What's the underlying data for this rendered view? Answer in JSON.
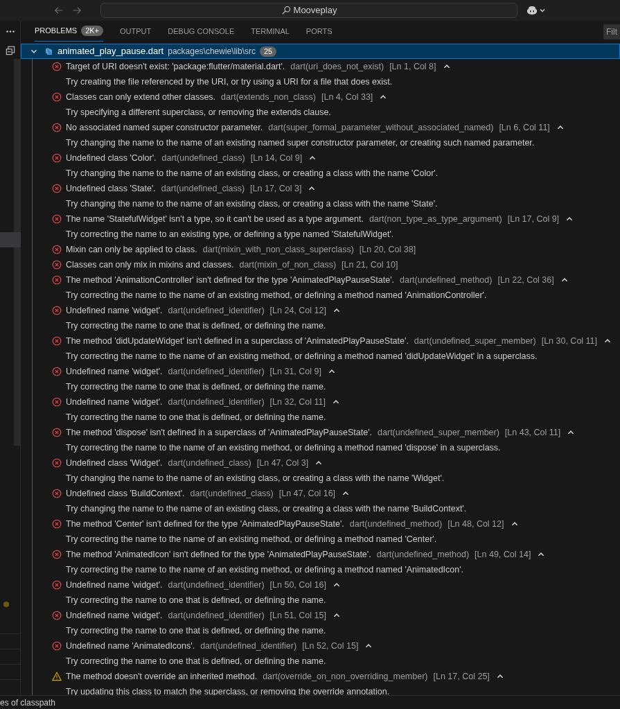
{
  "title_bar": {
    "search": "Mooveplay"
  },
  "panel": {
    "tabs": [
      {
        "label": "PROBLEMS",
        "selected": true,
        "badge": "2K+"
      },
      {
        "label": "OUTPUT",
        "selected": false
      },
      {
        "label": "DEBUG CONSOLE",
        "selected": false
      },
      {
        "label": "TERMINAL",
        "selected": false
      },
      {
        "label": "PORTS",
        "selected": false
      }
    ],
    "filter": {
      "placeholder": "Filt"
    }
  },
  "file": {
    "name": "animated_play_pause.dart",
    "path": "packages\\chewie\\lib\\src",
    "count": "25",
    "expanded": true,
    "selected": true
  },
  "problems": [
    {
      "kind": "error",
      "message": "Target of URI doesn't exist: 'package:flutter/material.dart'.",
      "source": "dart(uri_does_not_exist)",
      "location": "[Ln 1, Col 8]",
      "hint": "Try creating the file referenced by the URI, or try using a URI for a file that does exist."
    },
    {
      "kind": "error",
      "message": "Classes can only extend other classes.",
      "source": "dart(extends_non_class)",
      "location": "[Ln 4, Col 33]",
      "hint": "Try specifying a different superclass, or removing the extends clause."
    },
    {
      "kind": "error",
      "message": "No associated named super constructor parameter.",
      "source": "dart(super_formal_parameter_without_associated_named)",
      "location": "[Ln 6, Col 11]",
      "hint": "Try changing the name to the name of an existing named super constructor parameter, or creating such named parameter."
    },
    {
      "kind": "error",
      "message": "Undefined class 'Color'.",
      "source": "dart(undefined_class)",
      "location": "[Ln 14, Col 9]",
      "hint": "Try changing the name to the name of an existing class, or creating a class with the name 'Color'."
    },
    {
      "kind": "error",
      "message": "Undefined class 'State'.",
      "source": "dart(undefined_class)",
      "location": "[Ln 17, Col 3]",
      "hint": "Try changing the name to the name of an existing class, or creating a class with the name 'State'."
    },
    {
      "kind": "error",
      "message": "The name 'StatefulWidget' isn't a type, so it can't be used as a type argument.",
      "source": "dart(non_type_as_type_argument)",
      "location": "[Ln 17, Col 9]",
      "hint": "Try correcting the name to an existing type, or defining a type named 'StatefulWidget'."
    },
    {
      "kind": "error",
      "message": "Mixin can only be applied to class.",
      "source": "dart(mixin_with_non_class_superclass)",
      "location": "[Ln 20, Col 38]"
    },
    {
      "kind": "error",
      "message": "Classes can only mix in mixins and classes.",
      "source": "dart(mixin_of_non_class)",
      "location": "[Ln 21, Col 10]"
    },
    {
      "kind": "error",
      "message": "The method 'AnimationController' isn't defined for the type 'AnimatedPlayPauseState'.",
      "source": "dart(undefined_method)",
      "location": "[Ln 22, Col 36]",
      "hint": "Try correcting the name to the name of an existing method, or defining a method named 'AnimationController'."
    },
    {
      "kind": "error",
      "message": "Undefined name 'widget'.",
      "source": "dart(undefined_identifier)",
      "location": "[Ln 24, Col 12]",
      "hint": "Try correcting the name to one that is defined, or defining the name."
    },
    {
      "kind": "error",
      "message": "The method 'didUpdateWidget' isn't defined in a superclass of 'AnimatedPlayPauseState'.",
      "source": "dart(undefined_super_member)",
      "location": "[Ln 30, Col 11]",
      "hint": "Try correcting the name to the name of an existing method, or defining a method named 'didUpdateWidget' in a superclass."
    },
    {
      "kind": "error",
      "message": "Undefined name 'widget'.",
      "source": "dart(undefined_identifier)",
      "location": "[Ln 31, Col 9]",
      "hint": "Try correcting the name to one that is defined, or defining the name."
    },
    {
      "kind": "error",
      "message": "Undefined name 'widget'.",
      "source": "dart(undefined_identifier)",
      "location": "[Ln 32, Col 11]",
      "hint": "Try correcting the name to one that is defined, or defining the name."
    },
    {
      "kind": "error",
      "message": "The method 'dispose' isn't defined in a superclass of 'AnimatedPlayPauseState'.",
      "source": "dart(undefined_super_member)",
      "location": "[Ln 43, Col 11]",
      "hint": "Try correcting the name to the name of an existing method, or defining a method named 'dispose' in a superclass."
    },
    {
      "kind": "error",
      "message": "Undefined class 'Widget'.",
      "source": "dart(undefined_class)",
      "location": "[Ln 47, Col 3]",
      "hint": "Try changing the name to the name of an existing class, or creating a class with the name 'Widget'."
    },
    {
      "kind": "error",
      "message": "Undefined class 'BuildContext'.",
      "source": "dart(undefined_class)",
      "location": "[Ln 47, Col 16]",
      "hint": "Try changing the name to the name of an existing class, or creating a class with the name 'BuildContext'."
    },
    {
      "kind": "error",
      "message": "The method 'Center' isn't defined for the type 'AnimatedPlayPauseState'.",
      "source": "dart(undefined_method)",
      "location": "[Ln 48, Col 12]",
      "hint": "Try correcting the name to the name of an existing method, or defining a method named 'Center'."
    },
    {
      "kind": "error",
      "message": "The method 'AnimatedIcon' isn't defined for the type 'AnimatedPlayPauseState'.",
      "source": "dart(undefined_method)",
      "location": "[Ln 49, Col 14]",
      "hint": "Try correcting the name to the name of an existing method, or defining a method named 'AnimatedIcon'."
    },
    {
      "kind": "error",
      "message": "Undefined name 'widget'.",
      "source": "dart(undefined_identifier)",
      "location": "[Ln 50, Col 16]",
      "hint": "Try correcting the name to one that is defined, or defining the name."
    },
    {
      "kind": "error",
      "message": "Undefined name 'widget'.",
      "source": "dart(undefined_identifier)",
      "location": "[Ln 51, Col 15]",
      "hint": "Try correcting the name to one that is defined, or defining the name."
    },
    {
      "kind": "error",
      "message": "Undefined name 'AnimatedIcons'.",
      "source": "dart(undefined_identifier)",
      "location": "[Ln 52, Col 15]",
      "hint": "Try correcting the name to one that is defined, or defining the name."
    },
    {
      "kind": "warning",
      "message": "The method doesn't override an inherited method.",
      "source": "dart(override_on_non_overriding_member)",
      "location": "[Ln 17, Col 25]",
      "hint": "Try updating this class to match the superclass, or removing the override annotation."
    }
  ],
  "status_bar": {
    "text": "es of classpath"
  }
}
